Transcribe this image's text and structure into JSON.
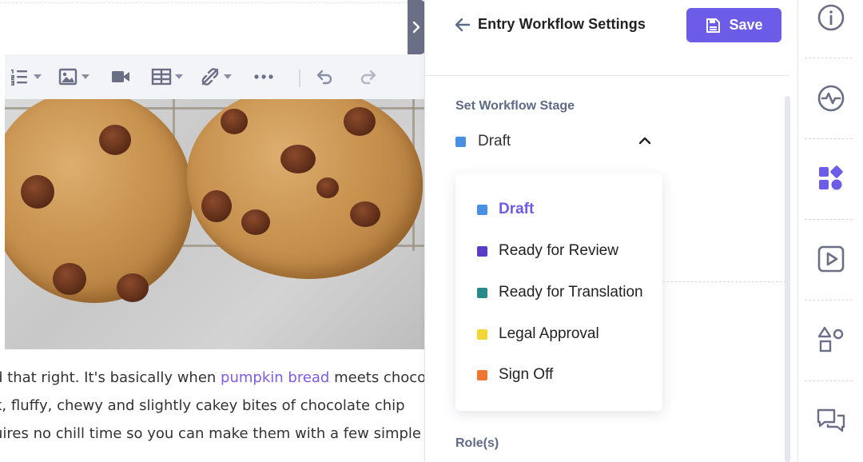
{
  "editor": {
    "paragraph_lines": [
      {
        "before": "d that right. It's basically when ",
        "link": "pumpkin bread",
        "after": " meets choco"
      },
      {
        "text": "k, fluffy, chewy and slightly cakey bites of chocolate chip"
      },
      {
        "text": "uires no chill time so you can make them with a few simple"
      }
    ],
    "toolbar_icons": [
      "numbered-list-icon",
      "image-icon",
      "video-icon",
      "table-icon",
      "unlink-icon",
      "more-icon",
      "undo-icon",
      "redo-icon"
    ],
    "photo_icon": "chocolate-chip-cookies-image"
  },
  "panel": {
    "title": "Entry Workflow Settings",
    "save_label": "Save",
    "stage_section_label": "Set Workflow Stage",
    "selected_stage": "Draft",
    "selected_color": "#4a90e2",
    "options": [
      {
        "label": "Draft",
        "color": "#4a90e2",
        "selected": true
      },
      {
        "label": "Ready for Review",
        "color": "#5b3cc4",
        "selected": false
      },
      {
        "label": "Ready for Translation",
        "color": "#2a8a8a",
        "selected": false
      },
      {
        "label": "Legal Approval",
        "color": "#f2d631",
        "selected": false
      },
      {
        "label": "Sign Off",
        "color": "#ee7630",
        "selected": false
      }
    ],
    "roles_label": "Role(s)"
  },
  "rail": {
    "icons": [
      "info-icon",
      "activity-icon",
      "workflow-icon",
      "play-icon",
      "shapes-icon",
      "comments-icon"
    ],
    "active": "workflow-icon"
  },
  "colors": {
    "accent": "#6c5ce7",
    "muted_text": "#5f6b86",
    "toolbar_bg": "#f3f4f8"
  }
}
